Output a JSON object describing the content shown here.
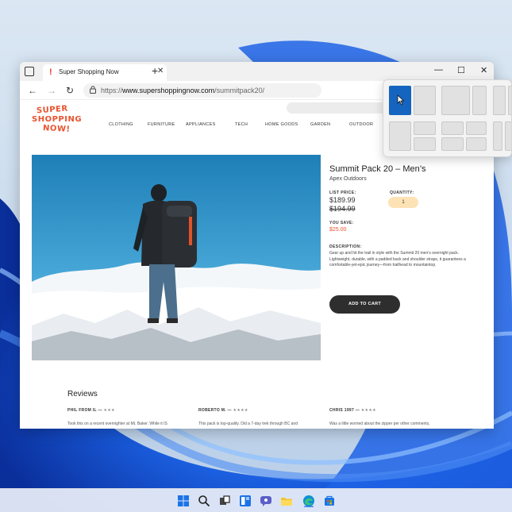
{
  "browser": {
    "tab_title": "Super Shopping Now",
    "tab_favicon": "!",
    "new_tab_label": "+",
    "tab_close": "✕",
    "url_prefix": "https://",
    "url_domain": "www.supershoppingnow.com",
    "url_path": "/summitpack20/",
    "window_controls": {
      "minimize": "—",
      "maximize": "☐",
      "close": "✕"
    },
    "nav": {
      "back": "←",
      "forward": "→",
      "refresh": "↻"
    }
  },
  "site": {
    "logo_lines": [
      "SUPER",
      "SHOPPING",
      "NOW!"
    ],
    "nav_links": [
      "CLOTHING",
      "FURNITURE",
      "APPLIANCES",
      "TECH",
      "HOME GOODS",
      "GARDEN",
      "OUTDOOR"
    ]
  },
  "product": {
    "title": "Summit Pack 20 – Men’s",
    "brand": "Apex Outdoors",
    "list_price_label": "LIST PRICE:",
    "price": "$189.99",
    "old_price": "$194.99",
    "quantity_label": "QUANTITY:",
    "quantity": "1",
    "you_save_label": "YOU SAVE:",
    "you_save": "$25.00",
    "description_label": "DESCRIPTION:",
    "description": "Gear up and hit the trail in style with the Summit 20 men’s overnight pack. Lightweight, durable, with a padded back and shoulder straps, it guarantees a comfortable-yet-epic journey—from trailhead to mountaintop.",
    "add_to_cart": "ADD TO CART"
  },
  "reviews": {
    "title": "Reviews",
    "items": [
      {
        "author": "PHIL FROM IL — ",
        "stars": "★★★",
        "text": "Took this on a recent overnighter at Mt. Baker. While it IS"
      },
      {
        "author": "ROBERTO M. — ",
        "stars": "★★★★",
        "text": "This pack is top-quality. Did a 7-day trek through BC and"
      },
      {
        "author": "CHRIS 1997 — ",
        "stars": "★★★★",
        "text": "Was a little worried about the zipper per other comments,"
      }
    ]
  },
  "colors": {
    "accent": "#e8532f",
    "snap_active": "#1565c0",
    "cart_button": "#2e2e2e",
    "qty_pill": "#fde2b5"
  },
  "taskbar": {
    "icons": [
      "windows-start-icon",
      "search-icon",
      "task-view-icon",
      "widgets-icon",
      "chat-icon",
      "edge-icon",
      "file-explorer-icon",
      "store-icon"
    ]
  }
}
